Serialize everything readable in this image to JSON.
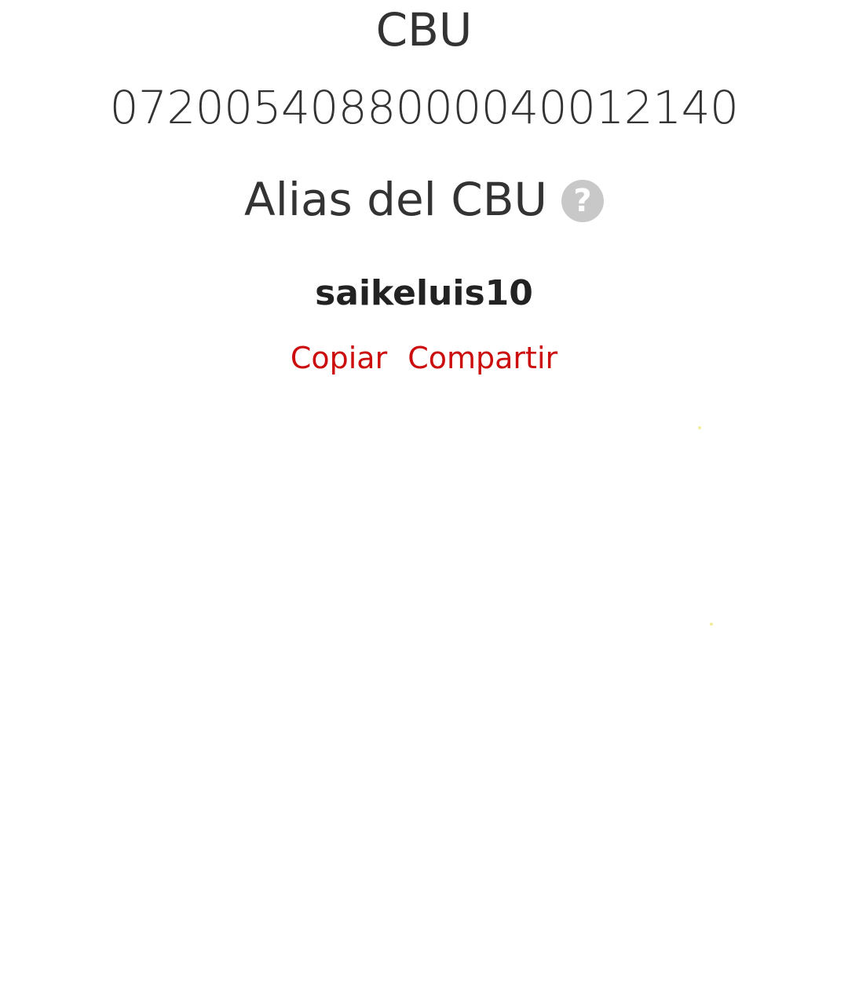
{
  "cbu": {
    "title": "CBU",
    "number": "0720054088000040012140"
  },
  "alias": {
    "title": "Alias del CBU",
    "help_icon": "question-circle-icon",
    "value": "saikeluis10"
  },
  "actions": {
    "copy_label": "Copiar",
    "share_label": "Compartir"
  },
  "colors": {
    "text": "#333333",
    "accent": "#cc0d0d",
    "help_icon_bg": "#c8c8c8"
  }
}
